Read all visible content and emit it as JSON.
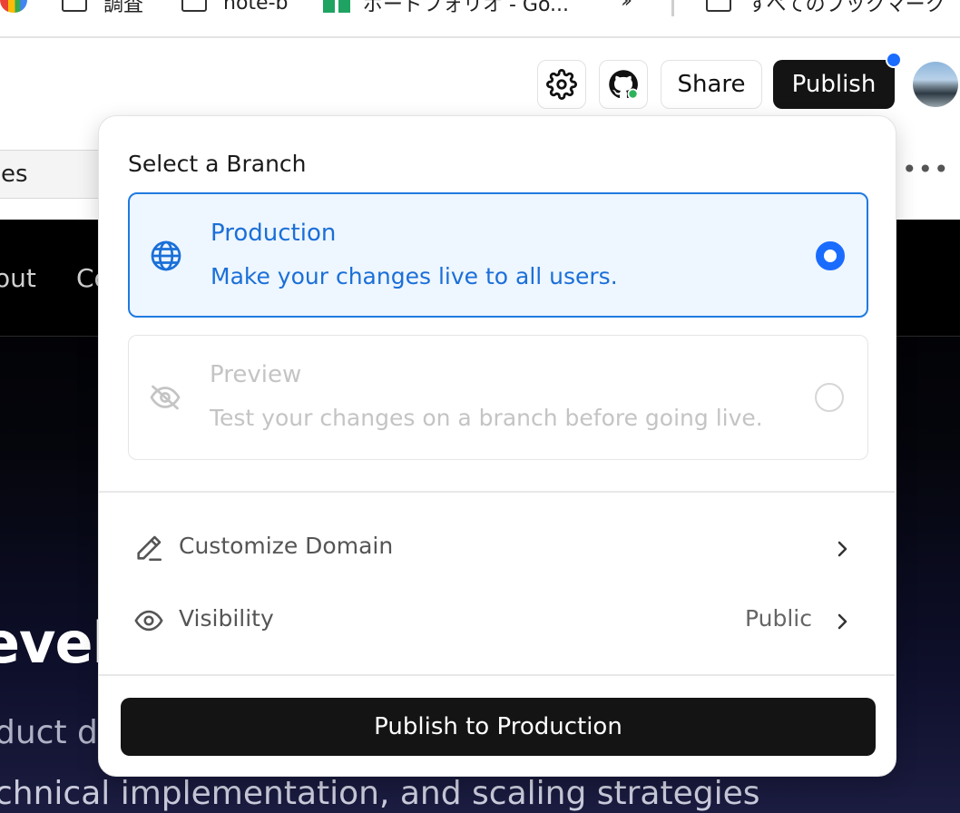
{
  "bookmarks": {
    "items": [
      {
        "label": "調査",
        "icon": "folder-icon"
      },
      {
        "label": "note-b",
        "icon": "folder-icon"
      },
      {
        "label": "ボードフォリオ - Go...",
        "icon": "sheets-icon"
      }
    ],
    "overflow_icon": "double-chevron-icon",
    "all_bookmarks": "すべてのブックマーク"
  },
  "toolbar": {
    "settings_icon": "gear-icon",
    "github_icon": "github-icon",
    "share_label": "Share",
    "publish_label": "Publish",
    "accent": "#1a6cff"
  },
  "background": {
    "input_text": "es",
    "nav_items": [
      "out",
      "Co"
    ],
    "hero": "evel",
    "sub_line1": "duct d",
    "sub_line2": "chnical implementation, and scaling strategies"
  },
  "popover": {
    "title": "Select a Branch",
    "branches": [
      {
        "name": "Production",
        "description": "Make your changes live to all users.",
        "icon": "globe-icon",
        "selected": true
      },
      {
        "name": "Preview",
        "description": "Test your changes on a branch before going live.",
        "icon": "eye-off-icon",
        "selected": false
      }
    ],
    "options": [
      {
        "label": "Customize Domain",
        "value": "",
        "icon": "pencil-icon"
      },
      {
        "label": "Visibility",
        "value": "Public",
        "icon": "eye-icon"
      }
    ],
    "action_label": "Publish to Production"
  }
}
